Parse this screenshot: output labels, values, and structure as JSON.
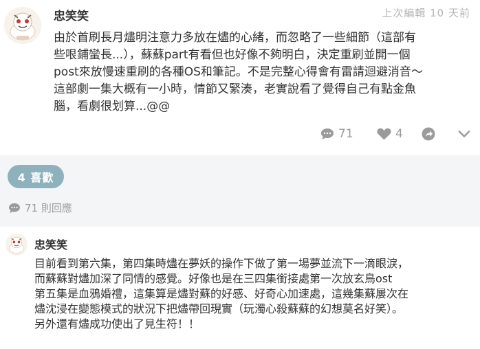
{
  "post": {
    "author": "忠笑笑",
    "time": "上次編輯 10 天前",
    "body_lines": [
      "由於首刷長月燼明注意力多放在燼的心緒，而忽略了一些細節（這部有",
      "些哏鋪蠻長...），蘇蘇part有看但也好像不夠明白，決定重刷並開一個",
      "post來放慢速重刷的各種OS和筆記。不是完整心得會有雷請迴避消音～",
      "這部劇一集大概有一小時，情節又緊湊，老實說看了覺得自己有點金魚",
      "腦，看劇很划算...@@"
    ],
    "actions": {
      "comment_count": "71",
      "like_count": "4",
      "comment_icon": "comment-bubble-icon",
      "like_icon": "heart-icon",
      "share_icon": "share-icon",
      "expand_icon": "chevron-down-icon"
    }
  },
  "likes_pill": "4 喜歡",
  "reply_count": "71 則回應",
  "comment": {
    "author": "忠笑笑",
    "body_lines": [
      "目前看到第六集，第四集時燼在夢妖的操作下做了第一場夢並流下一滴眼淚，",
      "而蘇蘇對燼加深了同情的感覺。好像也是在三四集銜接處第一次放玄鳥ost",
      "第五集是血鴉婚禮，這集算是燼對蘇的好感、好奇心加速處，這幾集蘇屢次在",
      "燼沈浸在變態模式的狀況下把燼帶回現實（玩濁心殺蘇蘇的幻想莫名好笑）。",
      "另外還有燼成功使出了見生符！！"
    ]
  },
  "colors": {
    "accent": "#8db1bd",
    "muted": "#9b9b9b",
    "band": "#f4f5f7"
  }
}
